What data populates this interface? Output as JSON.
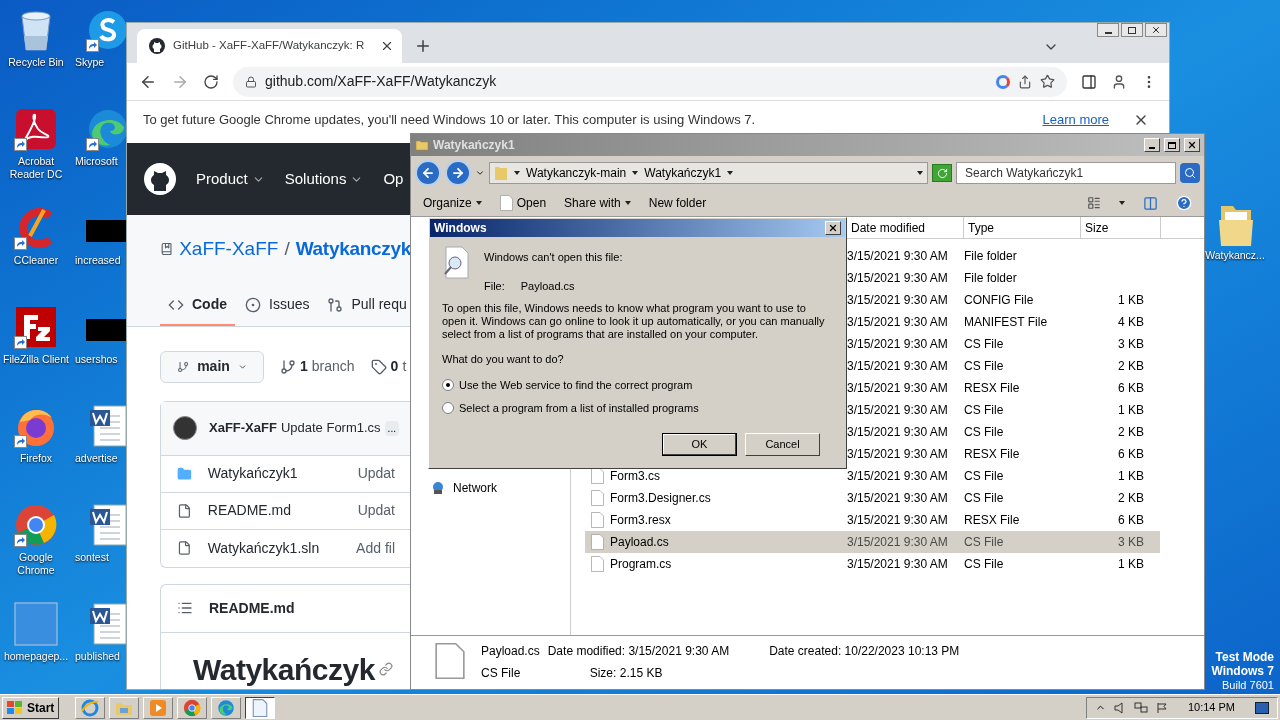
{
  "desktop_icons": [
    {
      "label": "Recycle Bin",
      "kind": "recycle",
      "shortcut": false
    },
    {
      "label": "Skype",
      "kind": "skype",
      "shortcut": true
    },
    {
      "label": "Acrobat Reader DC",
      "kind": "pdf",
      "shortcut": true
    },
    {
      "label": "Microsoft",
      "kind": "edge",
      "shortcut": true
    },
    {
      "label": "CCleaner",
      "kind": "ccleaner",
      "shortcut": true
    },
    {
      "label": "increased",
      "kind": "black",
      "shortcut": false
    },
    {
      "label": "FileZilla Client",
      "kind": "filezilla",
      "shortcut": true
    },
    {
      "label": "usershos",
      "kind": "black",
      "shortcut": false
    },
    {
      "label": "Firefox",
      "kind": "firefox",
      "shortcut": true
    },
    {
      "label": "advertise",
      "kind": "word",
      "shortcut": false
    },
    {
      "label": "Google Chrome",
      "kind": "chrome",
      "shortcut": true
    },
    {
      "label": "sontest",
      "kind": "word",
      "shortcut": false
    },
    {
      "label": "homepagep...",
      "kind": "blank",
      "shortcut": false
    },
    {
      "label": "published",
      "kind": "word",
      "shortcut": false
    }
  ],
  "desktop_folder": {
    "label": "Watykancz..."
  },
  "os_notice": [
    "Test Mode",
    "Windows 7",
    "Build 7601"
  ],
  "chrome": {
    "tab": {
      "title": "GitHub - XaFF-XaFF/Watykanczyk: R"
    },
    "url": "github.com/XaFF-XaFF/Watykanczyk",
    "infobar": {
      "message": "To get future Google Chrome updates, you'll need Windows 10 or later. This computer is using Windows 7.",
      "link": "Learn more"
    },
    "page": {
      "nav": [
        "Product",
        "Solutions",
        "Op"
      ],
      "owner": "XaFF-XaFF",
      "separator": "/",
      "repo": "Watykanczyk",
      "tabs": [
        {
          "label": "Code",
          "selected": true
        },
        {
          "label": "Issues",
          "selected": false
        },
        {
          "label": "Pull requ",
          "selected": false
        }
      ],
      "branch": "main",
      "branch_count": "1",
      "branch_word": "branch",
      "tags_count": "0",
      "tags_word": "t",
      "commit": {
        "author": "XaFF-XaFF",
        "message": "Update Form1.cs",
        "more": "..."
      },
      "files": [
        {
          "name": "Watykańczyk1",
          "kind": "folder",
          "commit": "Updat"
        },
        {
          "name": "README.md",
          "kind": "file",
          "commit": "Updat"
        },
        {
          "name": "Watykańczyk1.sln",
          "kind": "file",
          "commit": "Add fil"
        }
      ],
      "readme": {
        "title": "README.md",
        "heading": "Watykańczyk"
      }
    }
  },
  "explorer": {
    "title": "Watykańczyk1",
    "breadcrumb": [
      "Watykanczyk-main",
      "Watykańczyk1"
    ],
    "search": {
      "placeholder": "Search Watykańczyk1"
    },
    "toolbar": [
      {
        "label": "Organize",
        "kind": "menu"
      },
      {
        "label": "Open",
        "kind": "file"
      },
      {
        "label": "Share with",
        "kind": "menu"
      },
      {
        "label": "New folder",
        "kind": "plain"
      }
    ],
    "nav": [
      "Network"
    ],
    "columns": [
      "Date modified",
      "Type",
      "Size"
    ],
    "rows": [
      {
        "date": "3/15/2021 9:30 AM",
        "type": "File folder",
        "selected": false
      },
      {
        "date": "3/15/2021 9:30 AM",
        "type": "File folder",
        "selected": false
      },
      {
        "date": "3/15/2021 9:30 AM",
        "type": "CONFIG File",
        "size": "1 KB",
        "selected": false
      },
      {
        "date": "3/15/2021 9:30 AM",
        "type": "MANIFEST File",
        "size": "4 KB",
        "selected": false
      },
      {
        "date": "3/15/2021 9:30 AM",
        "type": "CS File",
        "size": "3 KB",
        "selected": false
      },
      {
        "date": "3/15/2021 9:30 AM",
        "type": "CS File",
        "size": "2 KB",
        "selected": false
      },
      {
        "date": "3/15/2021 9:30 AM",
        "type": "RESX File",
        "size": "6 KB",
        "selected": false
      },
      {
        "date": "3/15/2021 9:30 AM",
        "type": "CS File",
        "size": "1 KB",
        "selected": false
      },
      {
        "date": "3/15/2021 9:30 AM",
        "type": "CS File",
        "size": "2 KB",
        "selected": false
      },
      {
        "date": "3/15/2021 9:30 AM",
        "type": "RESX File",
        "size": "6 KB",
        "selected": false
      },
      {
        "name": "Form3.cs",
        "date": "3/15/2021 9:30 AM",
        "type": "CS File",
        "size": "1 KB",
        "selected": false
      },
      {
        "name": "Form3.Designer.cs",
        "date": "3/15/2021 9:30 AM",
        "type": "CS File",
        "size": "2 KB",
        "selected": false
      },
      {
        "name": "Form3.resx",
        "date": "3/15/2021 9:30 AM",
        "type": "RESX File",
        "size": "6 KB",
        "selected": false
      },
      {
        "name": "Payload.cs",
        "date": "3/15/2021 9:30 AM",
        "type": "CS File",
        "size": "3 KB",
        "selected": true
      },
      {
        "name": "Program.cs",
        "date": "3/15/2021 9:30 AM",
        "type": "CS File",
        "size": "1 KB",
        "selected": false
      }
    ],
    "details": {
      "name": "Payload.cs",
      "type": "CS File",
      "modified_label": "Date modified:",
      "modified": "3/15/2021 9:30 AM",
      "size_label": "Size:",
      "size": "2.15 KB",
      "created_label": "Date created:",
      "created": "10/22/2023 10:13 PM"
    }
  },
  "dialog": {
    "title": "Windows",
    "heading": "Windows can't open this file:",
    "file_label": "File:",
    "file_name": "Payload.cs",
    "body": "To open this file, Windows needs to know what program you want to use to open it. Windows can go online to look it up automatically, or you can manually select from a list of programs that are installed on your computer.",
    "question": "What do you want to do?",
    "options": [
      {
        "label": "Use the Web service to find the correct program",
        "selected": true
      },
      {
        "label": "Select a program from a list of installed programs",
        "selected": false
      }
    ],
    "buttons": [
      {
        "label": "OK",
        "default": true
      },
      {
        "label": "Cancel",
        "default": false
      }
    ]
  },
  "taskbar": {
    "start": "Start",
    "apps": [
      {
        "kind": "ie",
        "selected": false
      },
      {
        "kind": "explorer",
        "selected": false
      },
      {
        "kind": "media",
        "selected": false
      },
      {
        "kind": "chrome",
        "selected": false
      },
      {
        "kind": "edge",
        "selected": false
      },
      {
        "kind": "document",
        "selected": true
      }
    ],
    "time": "10:14 PM"
  }
}
